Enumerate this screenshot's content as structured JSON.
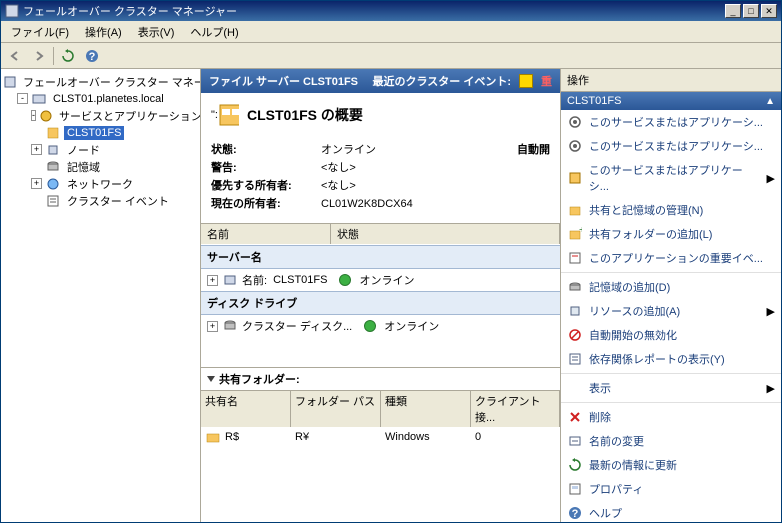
{
  "window": {
    "title": "フェールオーバー クラスター マネージャー"
  },
  "menu": {
    "file": "ファイル(F)",
    "action": "操作(A)",
    "view": "表示(V)",
    "help": "ヘルプ(H)"
  },
  "tree": {
    "root": "フェールオーバー クラスター マネージャー",
    "cluster": "CLST01.planetes.local",
    "services": "サービスとアプリケーション",
    "selected_app": "CLST01FS",
    "nodes": "ノード",
    "storage": "記憶域",
    "networks": "ネットワーク",
    "events": "クラスター イベント"
  },
  "center": {
    "header_title": "ファイル サーバー CLST01FS",
    "recent_events_label": "最近のクラスター イベント:",
    "recent_events_crit": "重",
    "overview_title": "CLST01FS の概要",
    "status_label": "状態:",
    "status_value": "オンライン",
    "auto_label": "自動開",
    "alert_label": "警告:",
    "alert_value": "<なし>",
    "pref_label": "優先する所有者:",
    "pref_value": "<なし>",
    "owner_label": "現在の所有者:",
    "owner_value": "CL01W2K8DCX64",
    "col_name": "名前",
    "col_status": "状態",
    "servers_group": "サーバー名",
    "server_name_label": "名前:",
    "server_name_value": "CLST01FS",
    "server_status": "オンライン",
    "disks_group": "ディスク ドライブ",
    "disk_name": "クラスター ディスク...",
    "disk_status": "オンライン",
    "share_toggle": "共有フォルダー:",
    "share_cols": {
      "name": "共有名",
      "path": "フォルダー パス",
      "type": "種類",
      "clients": "クライアント接..."
    },
    "share_row": {
      "name": "R$",
      "path": "R¥",
      "type": "Windows",
      "clients": "0"
    }
  },
  "actions": {
    "title": "操作",
    "group": "CLST01FS",
    "items": [
      {
        "label": "このサービスまたはアプリケーシ...",
        "arrow": false
      },
      {
        "label": "このサービスまたはアプリケーシ...",
        "arrow": false
      },
      {
        "label": "このサービスまたはアプリケーシ...",
        "arrow": true
      },
      {
        "label": "共有と記憶域の管理(N)",
        "arrow": false
      },
      {
        "label": "共有フォルダーの追加(L)",
        "arrow": false
      },
      {
        "label": "このアプリケーションの重要イベ...",
        "arrow": false
      },
      {
        "label": "記憶域の追加(D)",
        "arrow": false
      },
      {
        "label": "リソースの追加(A)",
        "arrow": true
      },
      {
        "label": "自動開始の無効化",
        "arrow": false
      },
      {
        "label": "依存関係レポートの表示(Y)",
        "arrow": false
      },
      {
        "label": "表示",
        "arrow": true
      },
      {
        "label": "削除",
        "arrow": false
      },
      {
        "label": "名前の変更",
        "arrow": false
      },
      {
        "label": "最新の情報に更新",
        "arrow": false
      },
      {
        "label": "プロパティ",
        "arrow": false
      },
      {
        "label": "ヘルプ",
        "arrow": false
      }
    ]
  }
}
